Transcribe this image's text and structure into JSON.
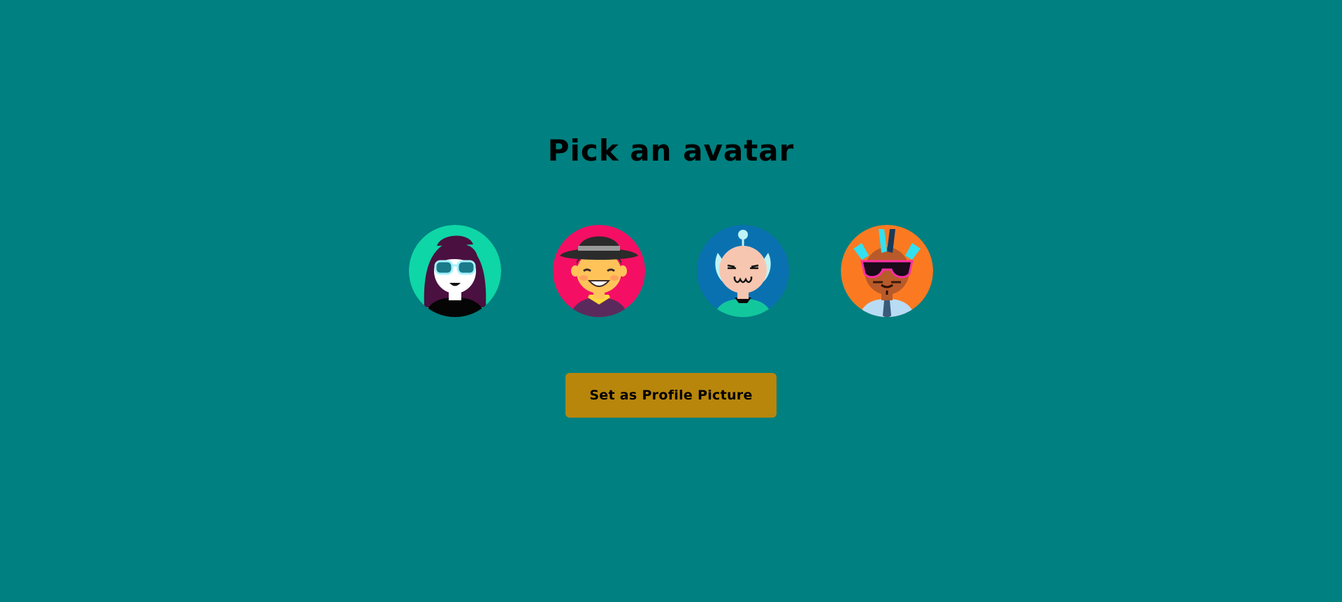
{
  "page": {
    "title": "Pick an avatar",
    "background_color": "#008080"
  },
  "avatars": [
    {
      "name": "avatar-woman-sunglasses",
      "bg_color": "#0fd6a6",
      "icon": "woman-purple-hair-sunglasses-icon"
    },
    {
      "name": "avatar-man-fedora",
      "bg_color": "#f50f64",
      "icon": "man-fedora-smiling-icon"
    },
    {
      "name": "avatar-alien",
      "bg_color": "#0a71b0",
      "icon": "alien-antenna-icon"
    },
    {
      "name": "avatar-punk-sunglasses",
      "bg_color": "#fb7a21",
      "icon": "punk-mohawk-sunglasses-icon"
    }
  ],
  "button": {
    "label": "Set as Profile Picture",
    "color": "#b8860b"
  }
}
